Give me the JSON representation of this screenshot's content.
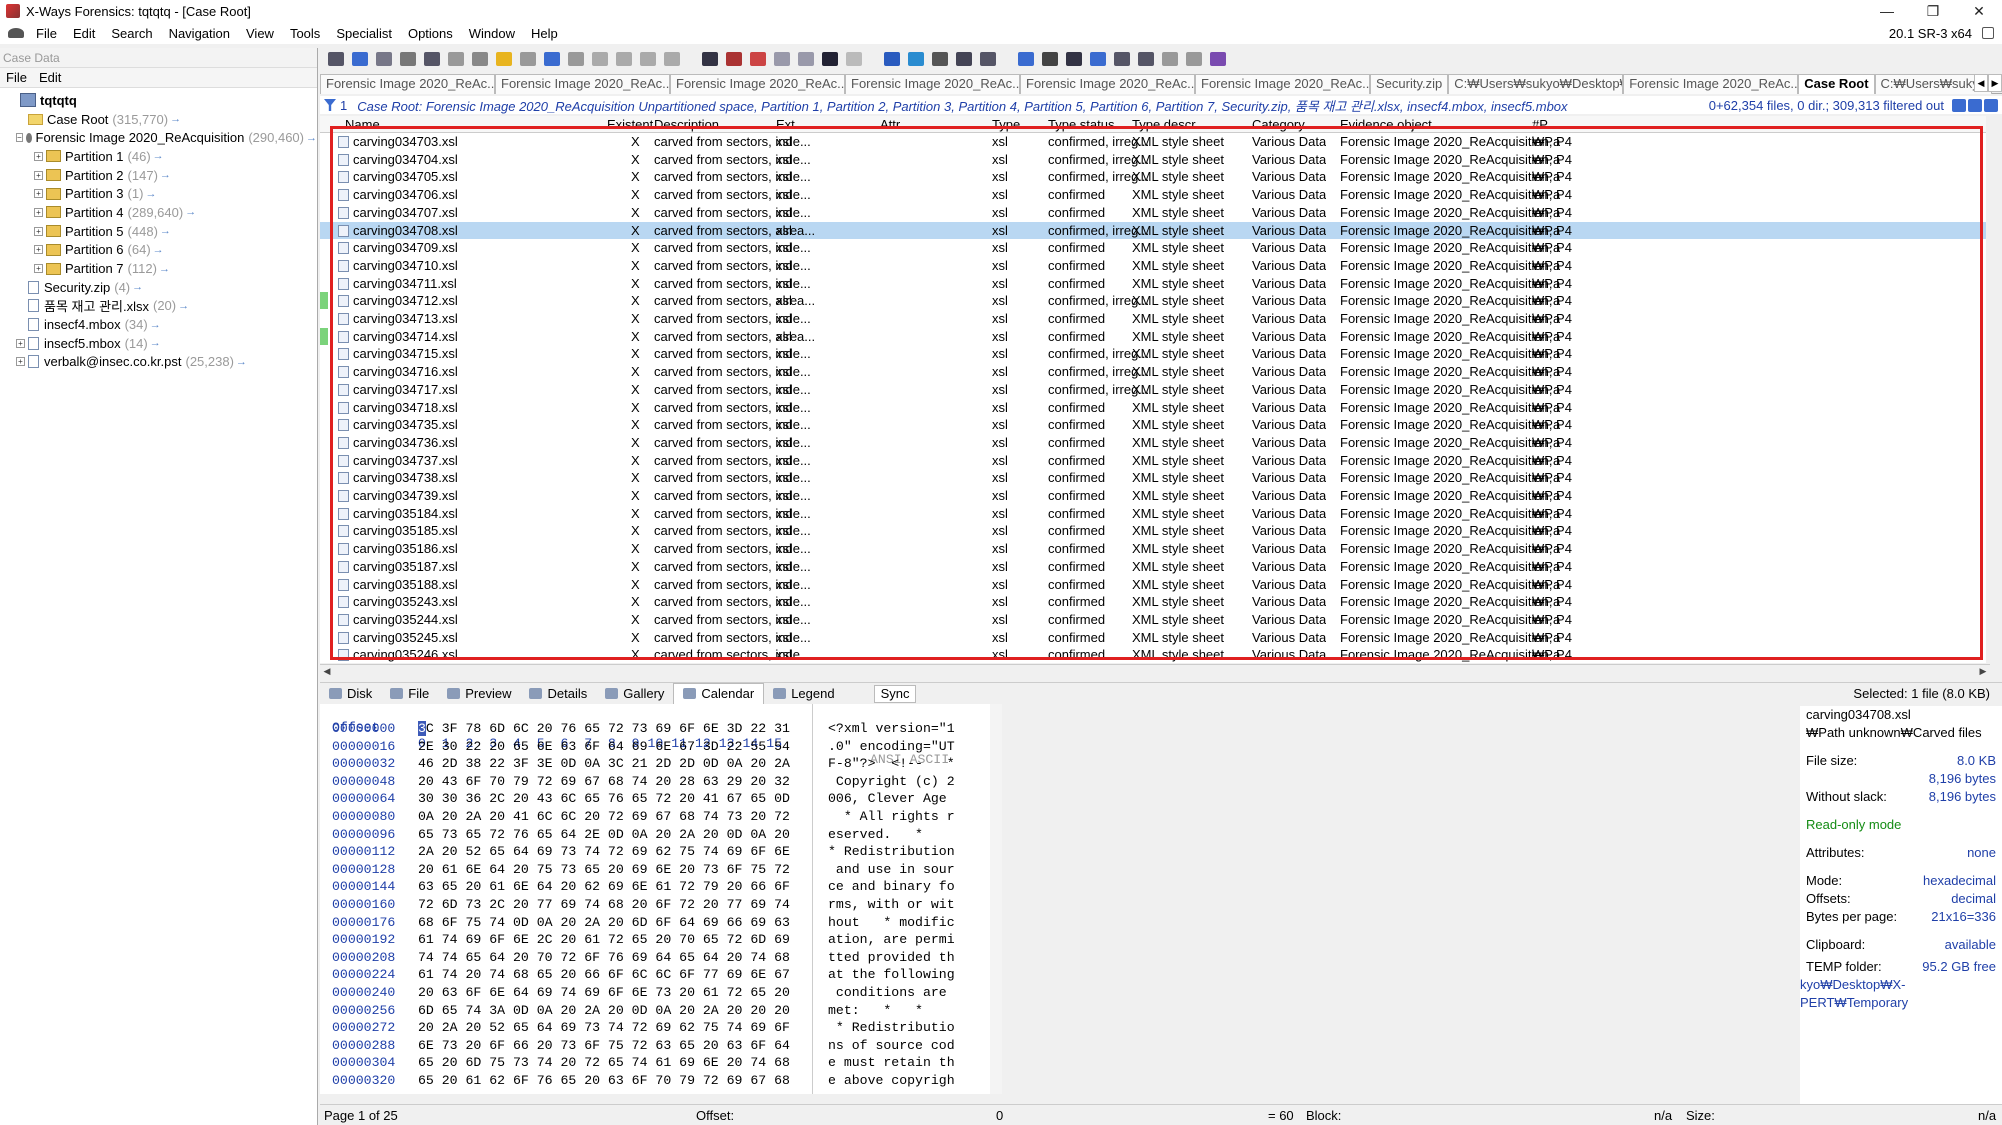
{
  "window": {
    "title": "X-Ways Forensics: tqtqtq - [Case Root]",
    "version": "20.1 SR-3 x64",
    "buttons": [
      "—",
      "❐",
      "✕"
    ]
  },
  "menu": [
    "File",
    "Edit",
    "Search",
    "Navigation",
    "View",
    "Tools",
    "Specialist",
    "Options",
    "Window",
    "Help"
  ],
  "case_data": {
    "title": "Case Data",
    "menu": [
      "File",
      "Edit"
    ],
    "tree": [
      {
        "label": "tqtqtq",
        "count": "",
        "level": 0,
        "kind": "root",
        "exp": ""
      },
      {
        "label": "Case Root",
        "count": "(315,770)",
        "level": 1,
        "kind": "folder",
        "exp": ""
      },
      {
        "label": "Forensic Image 2020_ReAcquisition",
        "count": "(290,460)",
        "level": 1,
        "kind": "disk",
        "exp": "−"
      },
      {
        "label": "Partition 1",
        "count": "(46)",
        "level": 2,
        "kind": "part",
        "exp": "+"
      },
      {
        "label": "Partition 2",
        "count": "(147)",
        "level": 2,
        "kind": "part",
        "exp": "+"
      },
      {
        "label": "Partition 3",
        "count": "(1)",
        "level": 2,
        "kind": "part",
        "exp": "+"
      },
      {
        "label": "Partition 4",
        "count": "(289,640)",
        "level": 2,
        "kind": "part",
        "exp": "+"
      },
      {
        "label": "Partition 5",
        "count": "(448)",
        "level": 2,
        "kind": "part",
        "exp": "+"
      },
      {
        "label": "Partition 6",
        "count": "(64)",
        "level": 2,
        "kind": "part",
        "exp": "+"
      },
      {
        "label": "Partition 7",
        "count": "(112)",
        "level": 2,
        "kind": "part",
        "exp": "+"
      },
      {
        "label": "Security.zip",
        "count": "(4)",
        "level": 1,
        "kind": "file",
        "exp": ""
      },
      {
        "label": "품목 재고 관리.xlsx",
        "count": "(20)",
        "level": 1,
        "kind": "file",
        "exp": ""
      },
      {
        "label": "insecf4.mbox",
        "count": "(34)",
        "level": 1,
        "kind": "file",
        "exp": ""
      },
      {
        "label": "insecf5.mbox",
        "count": "(14)",
        "level": 1,
        "kind": "file",
        "exp": "+"
      },
      {
        "label": "verbalk@insec.co.kr.pst",
        "count": "(25,238)",
        "level": 1,
        "kind": "file",
        "exp": "+"
      }
    ]
  },
  "tabs": [
    "Forensic Image 2020_ReAc...",
    "Forensic Image 2020_ReAc...",
    "Forensic Image 2020_ReAc...",
    "Forensic Image 2020_ReAc...",
    "Forensic Image 2020_ReAc...",
    "Forensic Image 2020_ReAc...",
    "Security.zip",
    "C:₩Users₩sukyo₩Desktop₩품...",
    "Forensic Image 2020_ReAc...",
    "Case Root",
    "C:₩Users₩sukyo"
  ],
  "active_tab": 9,
  "filter": {
    "num": "1",
    "text": "Case Root: Forensic Image 2020_ReAcquisition Unpartitioned space, Partition 1, Partition 2, Partition 3, Partition 4, Partition 5, Partition 6, Partition 7, Security.zip, 품목 재고 관리.xlsx, insecf4.mbox, insecf5.mbox",
    "stats": "0+62,354 files, 0 dir.; 309,313 filtered out"
  },
  "columns": [
    "Name",
    "Existent",
    "Description",
    "Ext.",
    "Attr.",
    "Type",
    "Type status",
    "Type descr.",
    "Category",
    "Evidence object",
    "#P"
  ],
  "rows": [
    {
      "name": "carving034703.xsl",
      "existent": "X",
      "desc": "carved from sectors, inde...",
      "ext": "xsl",
      "type": "xsl",
      "status": "confirmed, irreg...",
      "descr": "XML style sheet",
      "cat": "Various Data",
      "ev": "Forensic Image 2020_ReAcquisition, P4",
      "p": "₩Pa"
    },
    {
      "name": "carving034704.xsl",
      "existent": "X",
      "desc": "carved from sectors, inde...",
      "ext": "xsl",
      "type": "xsl",
      "status": "confirmed, irreg...",
      "descr": "XML style sheet",
      "cat": "Various Data",
      "ev": "Forensic Image 2020_ReAcquisition, P4",
      "p": "₩Pa"
    },
    {
      "name": "carving034705.xsl",
      "existent": "X",
      "desc": "carved from sectors, inde...",
      "ext": "xsl",
      "type": "xsl",
      "status": "confirmed, irreg...",
      "descr": "XML style sheet",
      "cat": "Various Data",
      "ev": "Forensic Image 2020_ReAcquisition, P4",
      "p": "₩Pa"
    },
    {
      "name": "carving034706.xsl",
      "existent": "X",
      "desc": "carved from sectors, inde...",
      "ext": "xsl",
      "type": "xsl",
      "status": "confirmed",
      "descr": "XML style sheet",
      "cat": "Various Data",
      "ev": "Forensic Image 2020_ReAcquisition, P4",
      "p": "₩Pa"
    },
    {
      "name": "carving034707.xsl",
      "existent": "X",
      "desc": "carved from sectors, inde...",
      "ext": "xsl",
      "type": "xsl",
      "status": "confirmed",
      "descr": "XML style sheet",
      "cat": "Various Data",
      "ev": "Forensic Image 2020_ReAcquisition, P4",
      "p": "₩Pa"
    },
    {
      "name": "carving034708.xsl",
      "existent": "X",
      "desc": "carved from sectors, alrea...",
      "ext": "xsl",
      "type": "xsl",
      "status": "confirmed, irreg...",
      "descr": "XML style sheet",
      "cat": "Various Data",
      "ev": "Forensic Image 2020_ReAcquisition, P4",
      "p": "₩Pa"
    },
    {
      "name": "carving034709.xsl",
      "existent": "X",
      "desc": "carved from sectors, inde...",
      "ext": "xsl",
      "type": "xsl",
      "status": "confirmed",
      "descr": "XML style sheet",
      "cat": "Various Data",
      "ev": "Forensic Image 2020_ReAcquisition, P4",
      "p": "₩Pa"
    },
    {
      "name": "carving034710.xsl",
      "existent": "X",
      "desc": "carved from sectors, inde...",
      "ext": "xsl",
      "type": "xsl",
      "status": "confirmed",
      "descr": "XML style sheet",
      "cat": "Various Data",
      "ev": "Forensic Image 2020_ReAcquisition, P4",
      "p": "₩Pa"
    },
    {
      "name": "carving034711.xsl",
      "existent": "X",
      "desc": "carved from sectors, inde...",
      "ext": "xsl",
      "type": "xsl",
      "status": "confirmed",
      "descr": "XML style sheet",
      "cat": "Various Data",
      "ev": "Forensic Image 2020_ReAcquisition, P4",
      "p": "₩Pa"
    },
    {
      "name": "carving034712.xsl",
      "existent": "X",
      "desc": "carved from sectors, alrea...",
      "ext": "xsl",
      "type": "xsl",
      "status": "confirmed, irreg...",
      "descr": "XML style sheet",
      "cat": "Various Data",
      "ev": "Forensic Image 2020_ReAcquisition, P4",
      "p": "₩Pa"
    },
    {
      "name": "carving034713.xsl",
      "existent": "X",
      "desc": "carved from sectors, inde...",
      "ext": "xsl",
      "type": "xsl",
      "status": "confirmed",
      "descr": "XML style sheet",
      "cat": "Various Data",
      "ev": "Forensic Image 2020_ReAcquisition, P4",
      "p": "₩Pa"
    },
    {
      "name": "carving034714.xsl",
      "existent": "X",
      "desc": "carved from sectors, alrea...",
      "ext": "xsl",
      "type": "xsl",
      "status": "confirmed",
      "descr": "XML style sheet",
      "cat": "Various Data",
      "ev": "Forensic Image 2020_ReAcquisition, P4",
      "p": "₩Pa"
    },
    {
      "name": "carving034715.xsl",
      "existent": "X",
      "desc": "carved from sectors, inde...",
      "ext": "xsl",
      "type": "xsl",
      "status": "confirmed, irreg...",
      "descr": "XML style sheet",
      "cat": "Various Data",
      "ev": "Forensic Image 2020_ReAcquisition, P4",
      "p": "₩Pa"
    },
    {
      "name": "carving034716.xsl",
      "existent": "X",
      "desc": "carved from sectors, inde...",
      "ext": "xsl",
      "type": "xsl",
      "status": "confirmed, irreg...",
      "descr": "XML style sheet",
      "cat": "Various Data",
      "ev": "Forensic Image 2020_ReAcquisition, P4",
      "p": "₩Pa"
    },
    {
      "name": "carving034717.xsl",
      "existent": "X",
      "desc": "carved from sectors, inde...",
      "ext": "xsl",
      "type": "xsl",
      "status": "confirmed, irreg...",
      "descr": "XML style sheet",
      "cat": "Various Data",
      "ev": "Forensic Image 2020_ReAcquisition, P4",
      "p": "₩Pa"
    },
    {
      "name": "carving034718.xsl",
      "existent": "X",
      "desc": "carved from sectors, inde...",
      "ext": "xsl",
      "type": "xsl",
      "status": "confirmed",
      "descr": "XML style sheet",
      "cat": "Various Data",
      "ev": "Forensic Image 2020_ReAcquisition, P4",
      "p": "₩Pa"
    },
    {
      "name": "carving034735.xsl",
      "existent": "X",
      "desc": "carved from sectors, inde...",
      "ext": "xsl",
      "type": "xsl",
      "status": "confirmed",
      "descr": "XML style sheet",
      "cat": "Various Data",
      "ev": "Forensic Image 2020_ReAcquisition, P4",
      "p": "₩Pa"
    },
    {
      "name": "carving034736.xsl",
      "existent": "X",
      "desc": "carved from sectors, inde...",
      "ext": "xsl",
      "type": "xsl",
      "status": "confirmed",
      "descr": "XML style sheet",
      "cat": "Various Data",
      "ev": "Forensic Image 2020_ReAcquisition, P4",
      "p": "₩Pa"
    },
    {
      "name": "carving034737.xsl",
      "existent": "X",
      "desc": "carved from sectors, inde...",
      "ext": "xsl",
      "type": "xsl",
      "status": "confirmed",
      "descr": "XML style sheet",
      "cat": "Various Data",
      "ev": "Forensic Image 2020_ReAcquisition, P4",
      "p": "₩Pa"
    },
    {
      "name": "carving034738.xsl",
      "existent": "X",
      "desc": "carved from sectors, inde...",
      "ext": "xsl",
      "type": "xsl",
      "status": "confirmed",
      "descr": "XML style sheet",
      "cat": "Various Data",
      "ev": "Forensic Image 2020_ReAcquisition, P4",
      "p": "₩Pa"
    },
    {
      "name": "carving034739.xsl",
      "existent": "X",
      "desc": "carved from sectors, inde...",
      "ext": "xsl",
      "type": "xsl",
      "status": "confirmed",
      "descr": "XML style sheet",
      "cat": "Various Data",
      "ev": "Forensic Image 2020_ReAcquisition, P4",
      "p": "₩Pa"
    },
    {
      "name": "carving035184.xsl",
      "existent": "X",
      "desc": "carved from sectors, inde...",
      "ext": "xsl",
      "type": "xsl",
      "status": "confirmed",
      "descr": "XML style sheet",
      "cat": "Various Data",
      "ev": "Forensic Image 2020_ReAcquisition, P4",
      "p": "₩Pa"
    },
    {
      "name": "carving035185.xsl",
      "existent": "X",
      "desc": "carved from sectors, inde...",
      "ext": "xsl",
      "type": "xsl",
      "status": "confirmed",
      "descr": "XML style sheet",
      "cat": "Various Data",
      "ev": "Forensic Image 2020_ReAcquisition, P4",
      "p": "₩Pa"
    },
    {
      "name": "carving035186.xsl",
      "existent": "X",
      "desc": "carved from sectors, inde...",
      "ext": "xsl",
      "type": "xsl",
      "status": "confirmed",
      "descr": "XML style sheet",
      "cat": "Various Data",
      "ev": "Forensic Image 2020_ReAcquisition, P4",
      "p": "₩Pa"
    },
    {
      "name": "carving035187.xsl",
      "existent": "X",
      "desc": "carved from sectors, inde...",
      "ext": "xsl",
      "type": "xsl",
      "status": "confirmed",
      "descr": "XML style sheet",
      "cat": "Various Data",
      "ev": "Forensic Image 2020_ReAcquisition, P4",
      "p": "₩Pa"
    },
    {
      "name": "carving035188.xsl",
      "existent": "X",
      "desc": "carved from sectors, inde...",
      "ext": "xsl",
      "type": "xsl",
      "status": "confirmed",
      "descr": "XML style sheet",
      "cat": "Various Data",
      "ev": "Forensic Image 2020_ReAcquisition, P4",
      "p": "₩Pa"
    },
    {
      "name": "carving035243.xsl",
      "existent": "X",
      "desc": "carved from sectors, inde...",
      "ext": "xsl",
      "type": "xsl",
      "status": "confirmed",
      "descr": "XML style sheet",
      "cat": "Various Data",
      "ev": "Forensic Image 2020_ReAcquisition, P4",
      "p": "₩Pa"
    },
    {
      "name": "carving035244.xsl",
      "existent": "X",
      "desc": "carved from sectors, inde...",
      "ext": "xsl",
      "type": "xsl",
      "status": "confirmed",
      "descr": "XML style sheet",
      "cat": "Various Data",
      "ev": "Forensic Image 2020_ReAcquisition, P4",
      "p": "₩Pa"
    },
    {
      "name": "carving035245.xsl",
      "existent": "X",
      "desc": "carved from sectors, inde...",
      "ext": "xsl",
      "type": "xsl",
      "status": "confirmed",
      "descr": "XML style sheet",
      "cat": "Various Data",
      "ev": "Forensic Image 2020_ReAcquisition, P4",
      "p": "₩Pa"
    },
    {
      "name": "carving035246.xsl",
      "existent": "X",
      "desc": "carved from sectors, inde...",
      "ext": "xsl",
      "type": "xsl",
      "status": "confirmed",
      "descr": "XML style sheet",
      "cat": "Various Data",
      "ev": "Forensic Image 2020_ReAcquisition, P4",
      "p": "₩Pa"
    }
  ],
  "selected_row": 5,
  "green_marks": [
    9,
    11
  ],
  "lower_tabs": [
    "Disk",
    "File",
    "Preview",
    "Details",
    "Gallery",
    "Calendar",
    "Legend"
  ],
  "active_lower_tab": 5,
  "sync_label": "Sync",
  "selected_info": "Selected: 1 file (8.0 KB)",
  "hex": {
    "header_offset": "Offset",
    "header_cols": "0  1  2  3  4  5  6  7  8  9 10 11 12 13 14 15",
    "header_ascii": "ANSI ASCII",
    "lines": [
      {
        "off": "00000000",
        "bytes": "3C 3F 78 6D 6C 20 76 65 72 73 69 6F 6E 3D 22 31",
        "ascii": "<?xml version=\"1"
      },
      {
        "off": "00000016",
        "bytes": "2E 30 22 20 65 6E 63 6F 64 69 6E 67 3D 22 55 54",
        "ascii": ".0\" encoding=\"UT"
      },
      {
        "off": "00000032",
        "bytes": "46 2D 38 22 3F 3E 0D 0A 3C 21 2D 2D 0D 0A 20 2A",
        "ascii": "F-8\"?>  <!--   *"
      },
      {
        "off": "00000048",
        "bytes": "20 43 6F 70 79 72 69 67 68 74 20 28 63 29 20 32",
        "ascii": " Copyright (c) 2"
      },
      {
        "off": "00000064",
        "bytes": "30 30 36 2C 20 43 6C 65 76 65 72 20 41 67 65 0D",
        "ascii": "006, Clever Age "
      },
      {
        "off": "00000080",
        "bytes": "0A 20 2A 20 41 6C 6C 20 72 69 67 68 74 73 20 72",
        "ascii": "  * All rights r"
      },
      {
        "off": "00000096",
        "bytes": "65 73 65 72 76 65 64 2E 0D 0A 20 2A 20 0D 0A 20",
        "ascii": "eserved.   *    "
      },
      {
        "off": "00000112",
        "bytes": "2A 20 52 65 64 69 73 74 72 69 62 75 74 69 6F 6E",
        "ascii": "* Redistribution"
      },
      {
        "off": "00000128",
        "bytes": "20 61 6E 64 20 75 73 65 20 69 6E 20 73 6F 75 72",
        "ascii": " and use in sour"
      },
      {
        "off": "00000144",
        "bytes": "63 65 20 61 6E 64 20 62 69 6E 61 72 79 20 66 6F",
        "ascii": "ce and binary fo"
      },
      {
        "off": "00000160",
        "bytes": "72 6D 73 2C 20 77 69 74 68 20 6F 72 20 77 69 74",
        "ascii": "rms, with or wit"
      },
      {
        "off": "00000176",
        "bytes": "68 6F 75 74 0D 0A 20 2A 20 6D 6F 64 69 66 69 63",
        "ascii": "hout   * modific"
      },
      {
        "off": "00000192",
        "bytes": "61 74 69 6F 6E 2C 20 61 72 65 20 70 65 72 6D 69",
        "ascii": "ation, are permi"
      },
      {
        "off": "00000208",
        "bytes": "74 74 65 64 20 70 72 6F 76 69 64 65 64 20 74 68",
        "ascii": "tted provided th"
      },
      {
        "off": "00000224",
        "bytes": "61 74 20 74 68 65 20 66 6F 6C 6C 6F 77 69 6E 67",
        "ascii": "at the following"
      },
      {
        "off": "00000240",
        "bytes": "20 63 6F 6E 64 69 74 69 6F 6E 73 20 61 72 65 20",
        "ascii": " conditions are "
      },
      {
        "off": "00000256",
        "bytes": "6D 65 74 3A 0D 0A 20 2A 20 0D 0A 20 2A 20 20 20",
        "ascii": "met:   *   *    "
      },
      {
        "off": "00000272",
        "bytes": "20 2A 20 52 65 64 69 73 74 72 69 62 75 74 69 6F",
        "ascii": " * Redistributio"
      },
      {
        "off": "00000288",
        "bytes": "6E 73 20 6F 66 20 73 6F 75 72 63 65 20 63 6F 64",
        "ascii": "ns of source cod"
      },
      {
        "off": "00000304",
        "bytes": "65 20 6D 75 73 74 20 72 65 74 61 69 6E 20 74 68",
        "ascii": "e must retain th"
      },
      {
        "off": "00000320",
        "bytes": "65 20 61 62 6F 76 65 20 63 6F 70 79 72 69 67 68",
        "ascii": "e above copyrigh"
      }
    ]
  },
  "info": {
    "filename": "carving034708.xsl",
    "path": "₩Path unknown₩Carved files",
    "file_size_label": "File size:",
    "file_size_kb": "8.0 KB",
    "file_size_bytes": "8,196 bytes",
    "without_slack_label": "Without slack:",
    "without_slack": "8,196 bytes",
    "readonly": "Read-only mode",
    "attributes_label": "Attributes:",
    "attributes": "none",
    "mode_label": "Mode:",
    "mode": "hexadecimal",
    "offsets_label": "Offsets:",
    "offsets": "decimal",
    "bpp_label": "Bytes per page:",
    "bpp": "21x16=336",
    "clipboard_label": "Clipboard:",
    "clipboard": "available",
    "temp_label": "TEMP folder:",
    "temp_free": "95.2 GB free",
    "temp_path": "kyo₩Desktop₩X-PERT₩Temporary"
  },
  "status": {
    "page": "Page 1 of 25",
    "offset_label": "Offset:",
    "offset_val": "0",
    "eq": "= 60",
    "block": "Block:",
    "block_val": "n/a",
    "size": "Size:",
    "size_val": "n/a"
  },
  "colors": {
    "accent": "#1f3fa8",
    "selection": "#b9d7f2",
    "highlight_box": "#e02020",
    "green": "#148c14"
  }
}
